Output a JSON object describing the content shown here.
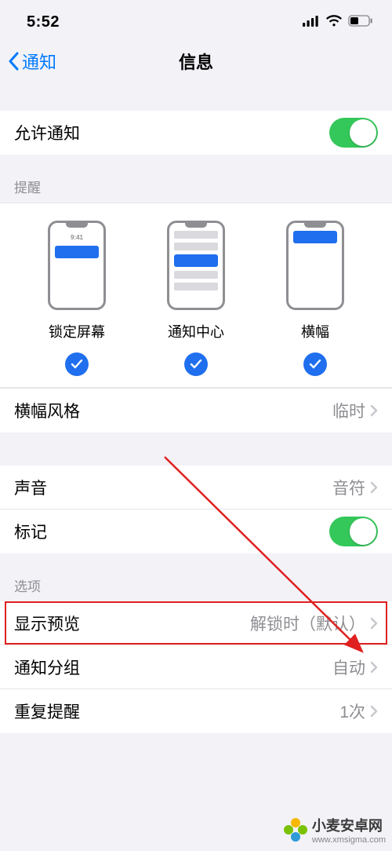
{
  "status": {
    "time": "5:52"
  },
  "nav": {
    "back": "通知",
    "title": "信息"
  },
  "allow": {
    "label": "允许通知",
    "on": true
  },
  "alerts_header": "提醒",
  "alerts": {
    "lock_time": "9:41",
    "items": [
      {
        "label": "锁定屏幕",
        "checked": true
      },
      {
        "label": "通知中心",
        "checked": true
      },
      {
        "label": "横幅",
        "checked": true
      }
    ]
  },
  "banner_style": {
    "label": "横幅风格",
    "value": "临时"
  },
  "sounds": {
    "label": "声音",
    "value": "音符"
  },
  "badges": {
    "label": "标记",
    "on": true
  },
  "options_header": "选项",
  "show_previews": {
    "label": "显示预览",
    "value": "解锁时（默认）"
  },
  "grouping": {
    "label": "通知分组",
    "value": "自动"
  },
  "repeat": {
    "label": "重复提醒",
    "value": "1次"
  },
  "watermark": {
    "title": "小麦安卓网",
    "url": "www.xmsigma.com"
  }
}
